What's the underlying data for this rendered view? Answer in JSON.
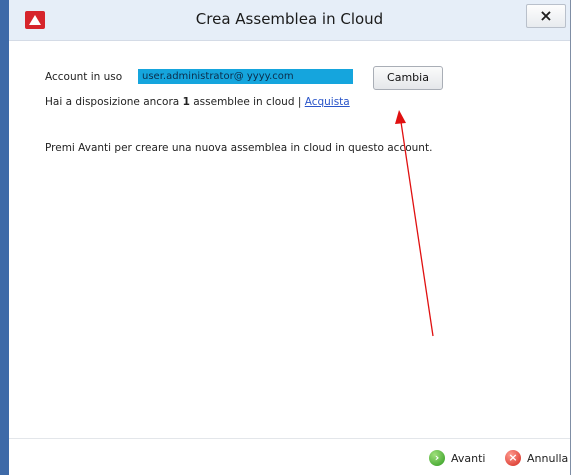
{
  "window": {
    "title": "Crea Assemblea in Cloud",
    "close_label": "×"
  },
  "account": {
    "label": "Account in uso",
    "value": "user.administrator@ yyyy.com",
    "change_button": "Cambia"
  },
  "availability": {
    "prefix": "Hai a disposizione ancora",
    "count": "1",
    "suffix": "assemblee in cloud |",
    "buy_link": "Acquista"
  },
  "instructions": "Premi Avanti per creare una nuova assemblea in cloud in questo account.",
  "footer": {
    "next_label": "Avanti",
    "cancel_label": "Annulla"
  },
  "colors": {
    "accent": "#3e6aa8",
    "app_icon": "#d6242b",
    "account_highlight": "#15a5dd",
    "annotation_arrow": "#e01010"
  },
  "icons": {
    "app": "app-logo-icon",
    "next": "green-arrow-icon",
    "cancel": "red-x-icon"
  }
}
